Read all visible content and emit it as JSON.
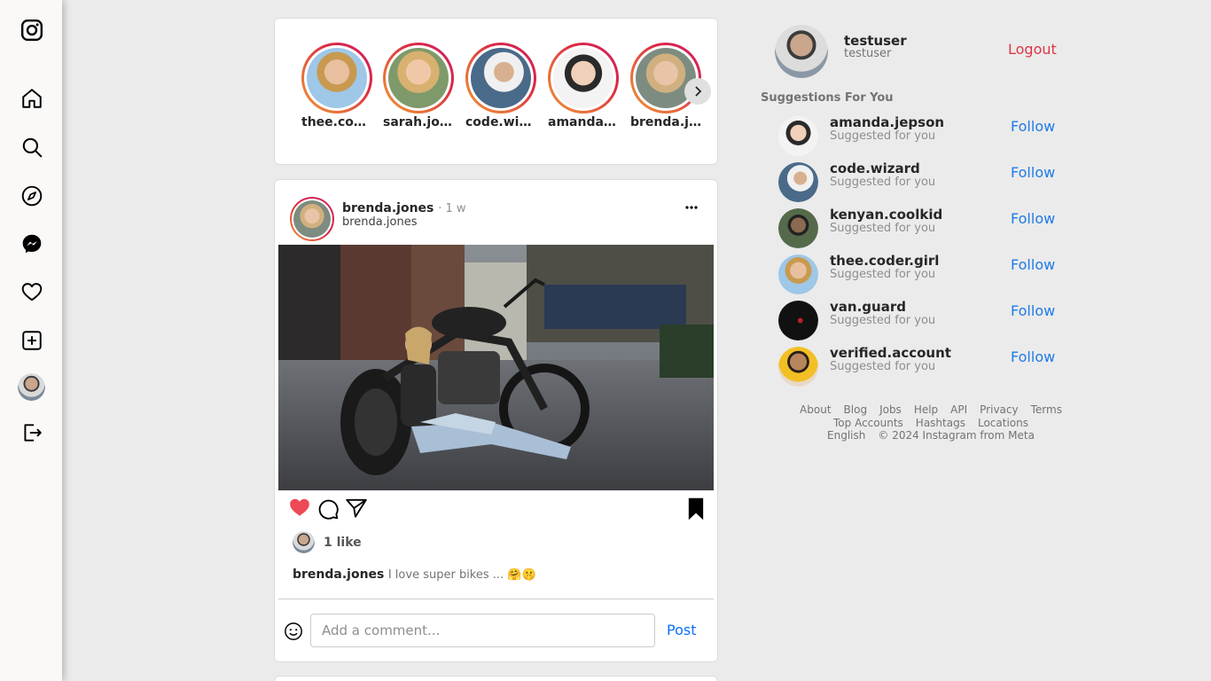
{
  "sidebar": {
    "items": [
      {
        "name": "instagram-logo-icon"
      },
      {
        "name": "home-icon"
      },
      {
        "name": "search-icon"
      },
      {
        "name": "explore-icon"
      },
      {
        "name": "messenger-icon"
      },
      {
        "name": "heart-icon"
      },
      {
        "name": "create-icon"
      },
      {
        "name": "profile-avatar"
      },
      {
        "name": "logout-icon"
      }
    ]
  },
  "stories": [
    {
      "username": "thee.cod…"
    },
    {
      "username": "sarah.joh…"
    },
    {
      "username": "code.wiz…"
    },
    {
      "username": "amanda.j…"
    },
    {
      "username": "brenda.jo…"
    }
  ],
  "post": {
    "username": "brenda.jones",
    "time": "· 1 w",
    "subtitle": "brenda.jones",
    "liked": true,
    "likes": "1 like",
    "caption_user": "brenda.jones",
    "caption_text": "I love super bikes ... 🤗🤫",
    "comment_placeholder": "Add a comment...",
    "post_label": "Post"
  },
  "profile": {
    "username": "testuser",
    "subtitle": "testuser",
    "logout_label": "Logout"
  },
  "suggestions": {
    "title": "Suggestions For You",
    "items": [
      {
        "username": "amanda.jepson",
        "subtitle": "Suggested for you",
        "action": "Follow"
      },
      {
        "username": "code.wizard",
        "subtitle": "Suggested for you",
        "action": "Follow"
      },
      {
        "username": "kenyan.coolkid",
        "subtitle": "Suggested for you",
        "action": "Follow"
      },
      {
        "username": "thee.coder.girl",
        "subtitle": "Suggested for you",
        "action": "Follow"
      },
      {
        "username": "van.guard",
        "subtitle": "Suggested for you",
        "action": "Follow"
      },
      {
        "username": "verified.account",
        "subtitle": "Suggested for you",
        "action": "Follow"
      }
    ]
  },
  "footer": {
    "links": [
      "About",
      "Blog",
      "Jobs",
      "Help",
      "API",
      "Privacy",
      "Terms"
    ],
    "links2": [
      "Top Accounts",
      "Hashtags",
      "Locations"
    ],
    "language": "English",
    "copyright": "© 2024 Instagram from Meta"
  },
  "colors": {
    "accent_blue": "#1e7be6",
    "logout_red": "#dc3545",
    "like_red": "#ed4956",
    "background": "#ebebeb"
  }
}
